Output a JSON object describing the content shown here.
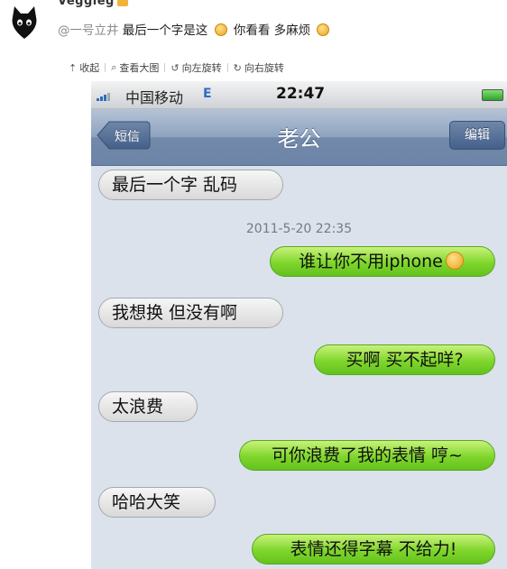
{
  "post": {
    "username": "Veggieg",
    "mention": "@一号立井",
    "comment_a": "最后一个字是这",
    "comment_b": "你看看 多麻烦"
  },
  "toolbar": {
    "collapse": "收起",
    "view_large": "查看大图",
    "rotate_left": "向左旋转",
    "rotate_right": "向右旋转"
  },
  "phone": {
    "carrier": "中国移动",
    "network": "E",
    "time": "22:47",
    "back_label": "短信",
    "title": "老公",
    "edit_label": "编辑",
    "timestamp": "2011-5-20 22:35",
    "messages": [
      {
        "dir": "in",
        "text": "最后一个字 乱码"
      },
      {
        "dir": "out",
        "text": "谁让你不用iphone"
      },
      {
        "dir": "in",
        "text": "我想换 但没有啊"
      },
      {
        "dir": "out",
        "text": "买啊 买不起咩?"
      },
      {
        "dir": "in",
        "text": "太浪费"
      },
      {
        "dir": "out",
        "text": "可你浪费了我的表情 哼~"
      },
      {
        "dir": "in",
        "text": "哈哈大笑"
      },
      {
        "dir": "out",
        "text": "表情还得字幕 不给力!"
      }
    ]
  }
}
